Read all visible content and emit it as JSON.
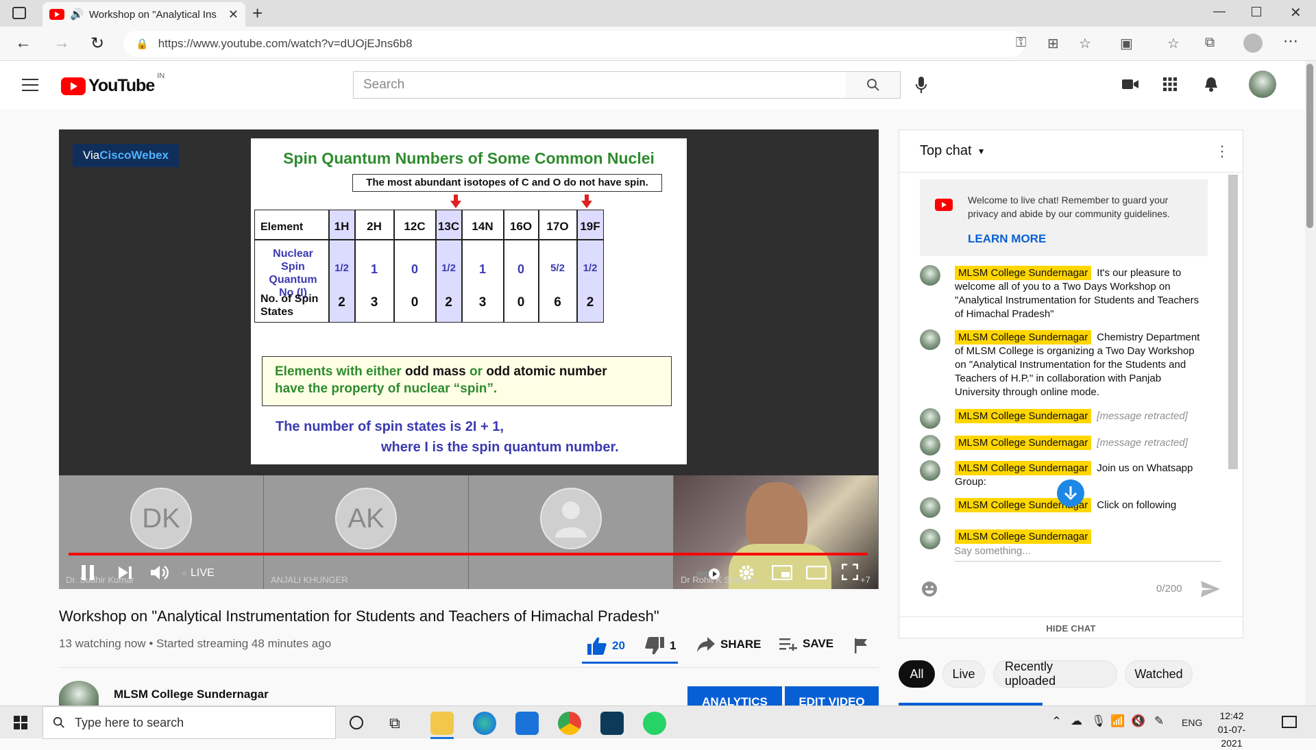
{
  "browser": {
    "tab_title": "Workshop on \"Analytical Ins",
    "url": "https://www.youtube.com/watch?v=dUOjEJns6b8"
  },
  "header": {
    "logo_text": "YouTube",
    "region": "IN",
    "search_placeholder": "Search"
  },
  "player": {
    "webex_via": "Via ",
    "webex_brand": "CiscoWebex",
    "live_label": "LIVE",
    "progress_fraction": 1.0,
    "more_count": "+7",
    "participants": [
      {
        "initials": "DK",
        "name": "Dr. Sudhir Kumar"
      },
      {
        "initials": "AK",
        "name": "ANJALI KHUNGER"
      },
      {
        "initials": "",
        "name": ""
      },
      {
        "initials": "",
        "name": "Dr Rohit K Sharma"
      }
    ],
    "slide": {
      "title": "Spin Quantum Numbers of Some Common Nuclei",
      "note": "The most abundant isotopes of C and O do not have spin.",
      "table_header": [
        "Element",
        "1H",
        "2H",
        "12C",
        "13C",
        "14N",
        "16O",
        "17O",
        "19F"
      ],
      "row1_label": "Nuclear Spin Quantum No (I)",
      "row1_values": [
        "1/2",
        "1",
        "0",
        "1/2",
        "1",
        "0",
        "5/2",
        "1/2"
      ],
      "row2_label": "No. of Spin States",
      "row2_values": [
        "2",
        "3",
        "0",
        "2",
        "3",
        "0",
        "6",
        "2"
      ],
      "box_line1a": "Elements with either ",
      "box_line1b": "odd mass",
      "box_line1c": " or ",
      "box_line1d": "odd atomic number",
      "box_line2": "have the property of nuclear “spin”.",
      "formula_line1": "The number of spin states is 2I + 1,",
      "formula_line2": "where I is the spin quantum number."
    }
  },
  "video": {
    "title": "Workshop on \"Analytical Instrumentation for Students and Teachers of Himachal Pradesh\"",
    "meta": "13 watching now • Started streaming 48 minutes ago",
    "likes": "20",
    "dislikes": "1",
    "share_label": "SHARE",
    "save_label": "SAVE",
    "channel_name": "MLSM College Sundernagar",
    "analytics_label": "ANALYTICS",
    "edit_label": "EDIT VIDEO"
  },
  "chat": {
    "mode": "Top chat",
    "welcome_text": "Welcome to live chat! Remember to guard your privacy and abide by our community guidelines.",
    "learn_more": "LEARN MORE",
    "messages": [
      {
        "author": "MLSM College Sundernagar",
        "text": "It's our pleasure to welcome all of you to a Two Days Workshop on \"Analytical Instrumentation for Students and Teachers of Himachal Pradesh\"",
        "retracted": false
      },
      {
        "author": "MLSM College Sundernagar",
        "text": "Chemistry Department of MLSM College is organizing a Two Day Workshop on \"Analytical Instrumentation for the Students and Teachers of H.P.\" in collaboration with Panjab University through online mode.",
        "retracted": false
      },
      {
        "author": "MLSM College Sundernagar",
        "text": "[message retracted]",
        "retracted": true
      },
      {
        "author": "MLSM College Sundernagar",
        "text": "[message retracted]",
        "retracted": true
      },
      {
        "author": "MLSM College Sundernagar",
        "text": "Join us on Whatsapp Group:",
        "retracted": false
      },
      {
        "author": "MLSM College Sundernagar",
        "text": "Click on following",
        "retracted": false
      },
      {
        "author": "MLSM College Sundernagar",
        "text": "",
        "retracted": false
      }
    ],
    "input_placeholder": "Say something...",
    "char_count": "0/200",
    "hide_chat": "HIDE CHAT"
  },
  "chips": [
    "All",
    "Live",
    "Recently uploaded",
    "Watched"
  ],
  "taskbar": {
    "search_placeholder": "Type here to search",
    "language": "ENG",
    "time": "12:42",
    "date": "01-07-2021"
  },
  "colors": {
    "youtube_red": "#ff0000",
    "accent_blue": "#065fd4",
    "author_badge": "#ffd600"
  }
}
